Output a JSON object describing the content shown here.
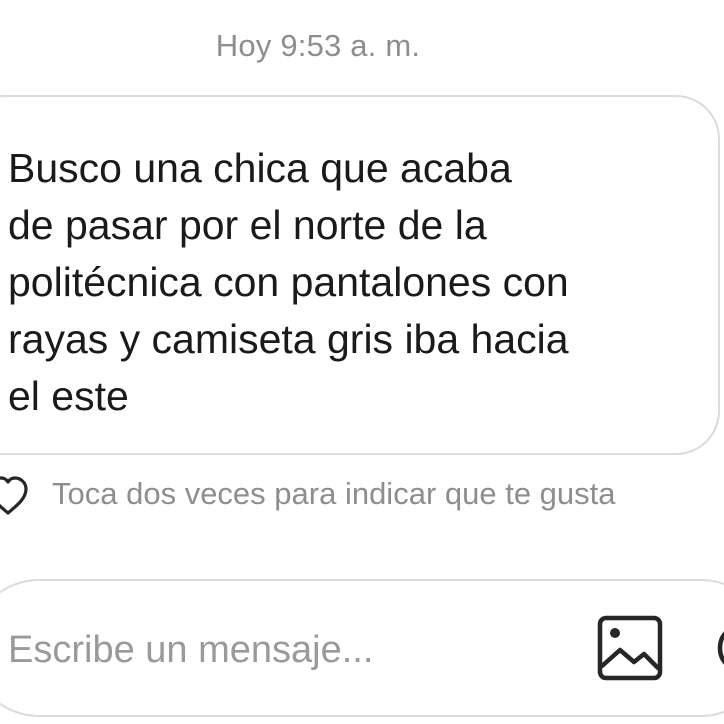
{
  "conversation": {
    "timestamp": "Hoy 9:53 a. m.",
    "message": {
      "text": "Busco una chica que acaba\nde pasar por el norte de la\npolitécnica con pantalones con\nrayas y camiseta gris iba hacia\nel este"
    },
    "like_hint": "Toca dos veces para indicar que te gusta"
  },
  "composer": {
    "placeholder": "Escribe un mensaje...",
    "buttons": {
      "gallery_icon": "image-icon",
      "sticker_icon": "sticker-icon"
    }
  }
}
